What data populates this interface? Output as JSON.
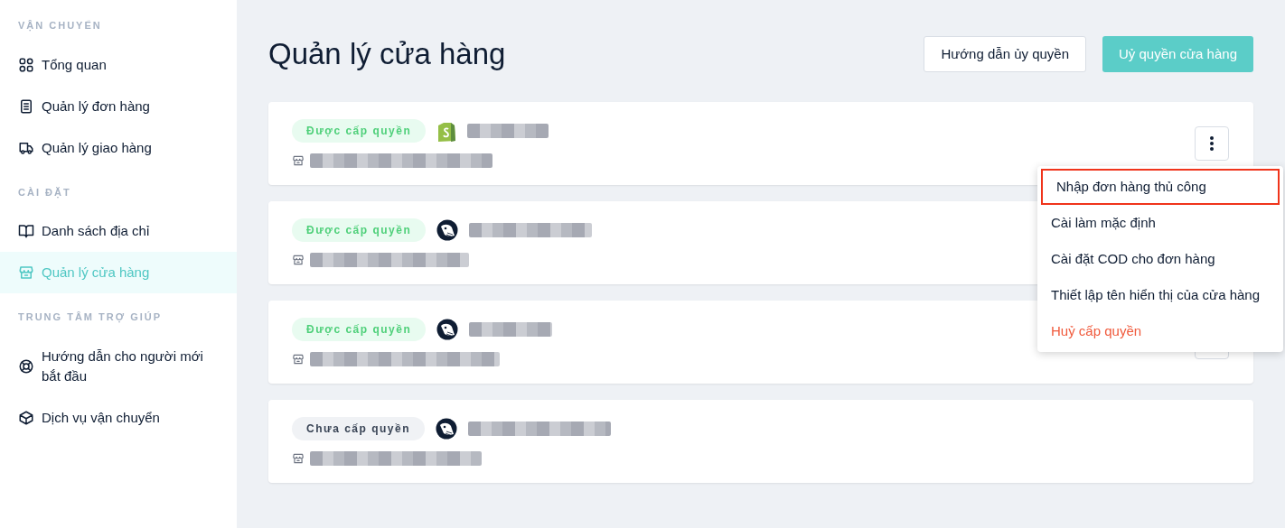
{
  "sidebar": {
    "sections": [
      {
        "heading": "VẬN CHUYỂN",
        "items": [
          {
            "label": "Tổng quan",
            "kind": "grid",
            "selected": false
          },
          {
            "label": "Quản lý đơn hàng",
            "kind": "clipboard",
            "selected": false
          },
          {
            "label": "Quản lý giao hàng",
            "kind": "truck",
            "selected": false
          }
        ]
      },
      {
        "heading": "CÀI ĐẶT",
        "items": [
          {
            "label": "Danh sách địa chỉ",
            "kind": "book",
            "selected": false
          },
          {
            "label": "Quản lý cửa hàng",
            "kind": "store",
            "selected": true
          }
        ]
      },
      {
        "heading": "TRUNG TÂM TRỢ GIÚP",
        "items": [
          {
            "label": "Hướng dẫn cho người mới bắt đầu",
            "kind": "lifebuoy",
            "selected": false
          },
          {
            "label": "Dịch vụ vận chuyển",
            "kind": "box",
            "selected": false
          }
        ]
      }
    ]
  },
  "page": {
    "title": "Quản lý cửa hàng",
    "buttons": [
      {
        "label": "Hướng dẫn ủy quyền",
        "kind": "outline"
      },
      {
        "label": "Uỷ quyền cửa hàng",
        "kind": "primary"
      }
    ]
  },
  "stores": [
    {
      "status": "Được cấp quyền",
      "authorized": true,
      "kind": "shopify",
      "menu_button": true
    },
    {
      "status": "Được cấp quyền",
      "authorized": true,
      "kind": "bird",
      "menu_button": false
    },
    {
      "status": "Được cấp quyền",
      "authorized": true,
      "kind": "bird",
      "menu_button": true
    },
    {
      "status": "Chưa cấp quyền",
      "authorized": false,
      "kind": "bird",
      "menu_button": false
    }
  ],
  "menu": {
    "items": [
      {
        "label": "Nhập đơn hàng thủ công",
        "kind": "normal",
        "outlined": true
      },
      {
        "label": "Cài làm mặc định",
        "kind": "normal",
        "outlined": false
      },
      {
        "label": "Cài đặt COD cho đơn hàng",
        "kind": "normal",
        "outlined": false
      },
      {
        "label": "Thiết lập tên hiển thị của cửa hàng",
        "kind": "normal",
        "outlined": false
      },
      {
        "label": "Huỷ cấp quyền",
        "kind": "danger",
        "outlined": false
      }
    ]
  }
}
